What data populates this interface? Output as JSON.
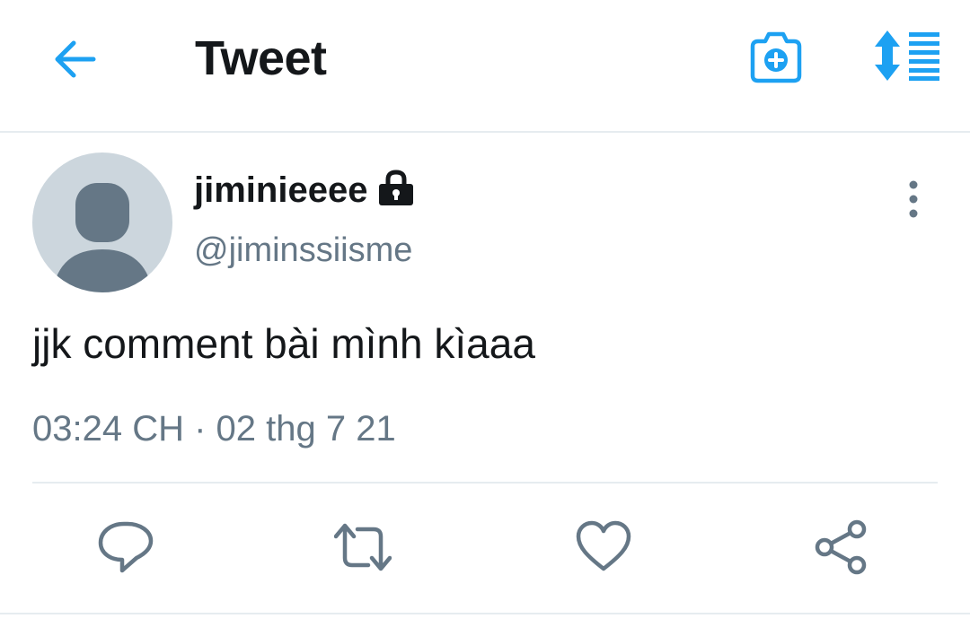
{
  "header": {
    "title": "Tweet",
    "back_icon": "arrow-left-icon",
    "camera_icon": "camera-plus-icon",
    "sort_icon": "sort-arrows-icon"
  },
  "tweet": {
    "display_name": "jiminieeee",
    "protected_icon": "lock-icon",
    "handle": "@jiminssiisme",
    "text": "jjk comment bài mình kìaaa",
    "timestamp": "03:24 CH · 02 thg 7 21"
  },
  "actions": {
    "reply_icon": "reply-icon",
    "retweet_icon": "retweet-icon",
    "like_icon": "heart-icon",
    "share_icon": "share-icon"
  },
  "colors": {
    "accent": "#1da1f2",
    "text_primary": "#14171a",
    "text_secondary": "#657786",
    "divider": "#e6ecf0",
    "avatar_bg": "#ccd6dd",
    "avatar_fg": "#657786"
  }
}
